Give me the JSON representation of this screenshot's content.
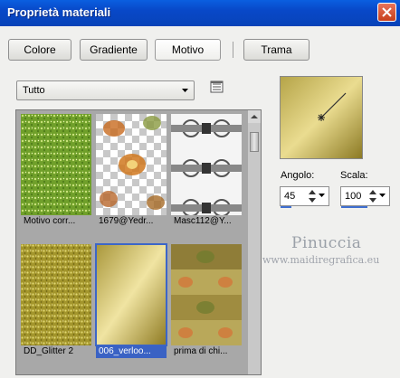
{
  "window": {
    "title": "Proprietà materiali"
  },
  "tabs": [
    {
      "label": "Colore",
      "active": false
    },
    {
      "label": "Gradiente",
      "active": false
    },
    {
      "label": "Motivo",
      "active": true
    },
    {
      "label": "Trama",
      "active": false
    }
  ],
  "category": {
    "selected": "Tutto"
  },
  "patterns": [
    {
      "caption": "Motivo corr...",
      "selected": false
    },
    {
      "caption": "1679@Yedr...",
      "selected": false
    },
    {
      "caption": "Masc112@Y...",
      "selected": false
    },
    {
      "caption": "DD_Glitter 2",
      "selected": false
    },
    {
      "caption": "006_verloo...",
      "selected": true
    },
    {
      "caption": "prima di chi...",
      "selected": false
    }
  ],
  "controls": {
    "angle_label": "Angolo:",
    "angle_value": "45",
    "scale_label": "Scala:",
    "scale_value": "100",
    "scale_fill_fraction": 0.55
  },
  "watermark": {
    "name": "Pinuccia",
    "url": "www.maidiregrafica.eu"
  },
  "colors": {
    "title_bar": "#0848c8",
    "selection": "#3a62c4",
    "close_button": "#c8401c"
  }
}
